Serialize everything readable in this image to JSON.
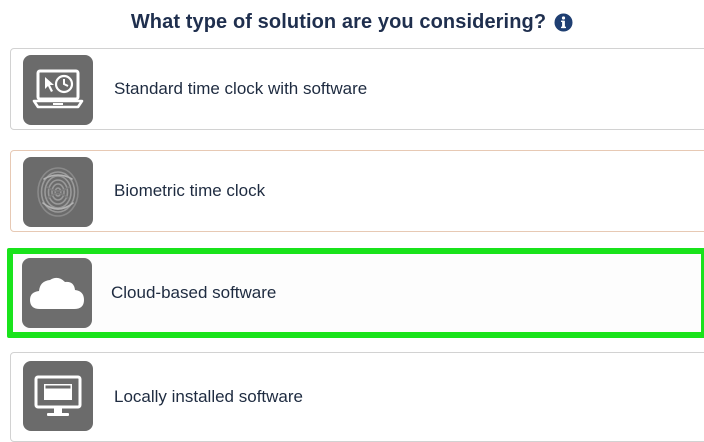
{
  "question": {
    "title": "What type of solution are you considering?",
    "info_icon": "info-circle-icon"
  },
  "options": [
    {
      "label": "Standard time clock with software",
      "icon": "laptop-clock-icon",
      "selected": false
    },
    {
      "label": "Biometric time clock",
      "icon": "fingerprint-icon",
      "selected": false
    },
    {
      "label": "Cloud-based software",
      "icon": "cloud-icon",
      "selected": true
    },
    {
      "label": "Locally installed software",
      "icon": "desktop-monitor-icon",
      "selected": false
    }
  ],
  "colors": {
    "title": "#1f2f4e",
    "info_icon": "#1f3f72",
    "tile": "#6b6b6b",
    "selected_border": "#19e31b"
  }
}
